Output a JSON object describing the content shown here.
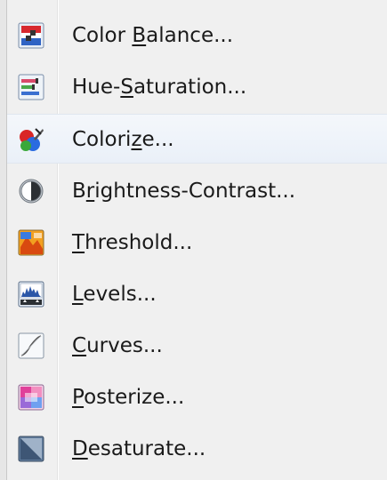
{
  "menu": {
    "items": [
      {
        "label": "Color Balance...",
        "pre": "Color ",
        "mn": "B",
        "post": "alance...",
        "icon": "color-balance-icon"
      },
      {
        "label": "Hue-Saturation...",
        "pre": "Hue-",
        "mn": "S",
        "post": "aturation...",
        "icon": "hue-saturation-icon"
      },
      {
        "label": "Colorize...",
        "pre": "Colori",
        "mn": "z",
        "post": "e...",
        "icon": "colorize-icon"
      },
      {
        "label": "Brightness-Contrast...",
        "pre": "B",
        "mn": "r",
        "post": "ightness-Contrast...",
        "icon": "brightness-contrast-icon"
      },
      {
        "label": "Threshold...",
        "pre": "",
        "mn": "T",
        "post": "hreshold...",
        "icon": "threshold-icon"
      },
      {
        "label": "Levels...",
        "pre": "",
        "mn": "L",
        "post": "evels...",
        "icon": "levels-icon"
      },
      {
        "label": "Curves...",
        "pre": "",
        "mn": "C",
        "post": "urves...",
        "icon": "curves-icon"
      },
      {
        "label": "Posterize...",
        "pre": "",
        "mn": "P",
        "post": "osterize...",
        "icon": "posterize-icon"
      },
      {
        "label": "Desaturate...",
        "pre": "",
        "mn": "D",
        "post": "esaturate...",
        "icon": "desaturate-icon"
      }
    ],
    "hovered_item": "Colorize...",
    "colors": {
      "background": "#f0f0f0",
      "hover": "#eaf0f8",
      "text": "#1a1a1a"
    }
  }
}
